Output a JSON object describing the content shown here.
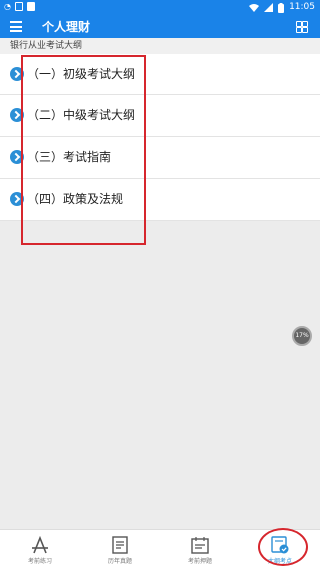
{
  "status_bar": {
    "time": "11:05"
  },
  "app_bar": {
    "title": "个人理财"
  },
  "section": {
    "header": "银行从业考试大纲"
  },
  "outline": {
    "items": [
      {
        "label": "（一）初级考试大纲"
      },
      {
        "label": "（二）中级考试大纲"
      },
      {
        "label": "（三）考试指南"
      },
      {
        "label": "（四）政策及法规"
      }
    ]
  },
  "progress_badge": {
    "value": "17%"
  },
  "bottom_nav": {
    "items": [
      {
        "label": "考前练习",
        "icon": "app-store-icon"
      },
      {
        "label": "历年真题",
        "icon": "document-icon"
      },
      {
        "label": "考前押题",
        "icon": "calendar-icon"
      },
      {
        "label": "大纲考点",
        "icon": "outline-check-icon",
        "active": true
      }
    ]
  },
  "colors": {
    "primary": "#1a83e8",
    "annotation_red": "#d6262d",
    "bullet_blue": "#2b8fd6"
  }
}
